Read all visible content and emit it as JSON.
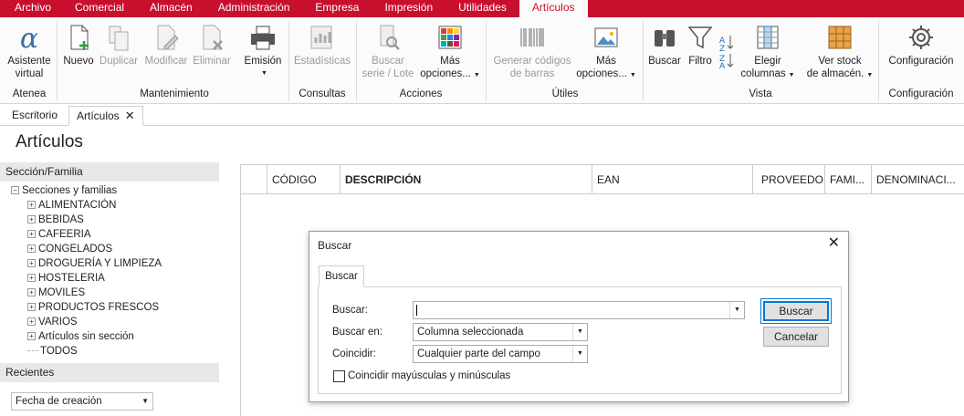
{
  "menu": [
    "Archivo",
    "Comercial",
    "Almacén",
    "Administración",
    "Empresa",
    "Impresión",
    "Utilidades",
    "Artículos"
  ],
  "ribbon": {
    "atenea": {
      "label1": "Asistente",
      "label2": "virtual",
      "group": "Atenea"
    },
    "nuevo": "Nuevo",
    "duplicar": "Duplicar",
    "modificar": "Modificar",
    "eliminar": "Eliminar",
    "emision": "Emisión",
    "mant_group": "Mantenimiento",
    "estadisticas": "Estadísticas",
    "consultas_group": "Consultas",
    "buscar_serie1": "Buscar",
    "buscar_serie2": "serie / Lote",
    "mas_opc1": "Más",
    "mas_opc2": "opciones...",
    "acciones_group": "Acciones",
    "gen_cod1": "Generar códigos",
    "gen_cod2": "de barras",
    "mas_opc_b1": "Más",
    "mas_opc_b2": "opciones...",
    "utiles_group": "Útiles",
    "buscar": "Buscar",
    "filtro": "Filtro",
    "elegir1": "Elegir",
    "elegir2": "columnas",
    "stock1": "Ver stock",
    "stock2": "de almacén.",
    "vista_group": "Vista",
    "config": "Configuración",
    "config_group": "Configuración"
  },
  "tabs": {
    "escritorio": "Escritorio",
    "articulos": "Artículos"
  },
  "page_title": "Artículos",
  "left": {
    "section_head": "Sección/Familia",
    "root": "Secciones y familias",
    "items": [
      "ALIMENTACIÓN",
      "BEBIDAS",
      "CAFEERIA",
      "CONGELADOS",
      "DROGUERÍA Y LIMPIEZA",
      "HOSTELERIA",
      "MOVILES",
      "PRODUCTOS FRESCOS",
      "VARIOS",
      "Artículos sin sección"
    ],
    "todos": "TODOS",
    "recientes": "Recientes",
    "recientes_value": "Fecha de creación"
  },
  "grid_headers": [
    "CÓDIGO",
    "DESCRIPCIÓN",
    "EAN",
    "PROVEEDOR",
    "FAMI...",
    "DENOMINACI..."
  ],
  "dialog": {
    "title": "Buscar",
    "tab": "Buscar",
    "buscar_lbl": "Buscar:",
    "buscar_value": "",
    "buscar_en_lbl": "Buscar en:",
    "buscar_en_value": "Columna seleccionada",
    "coincidir_lbl": "Coincidir:",
    "coincidir_value": "Cualquier parte del campo",
    "check_lbl": "Coincidir mayúsculas y minúsculas",
    "btn_buscar": "Buscar",
    "btn_cancelar": "Cancelar"
  },
  "colors": {
    "brand": "#c8102e",
    "focus": "#0078d7"
  }
}
